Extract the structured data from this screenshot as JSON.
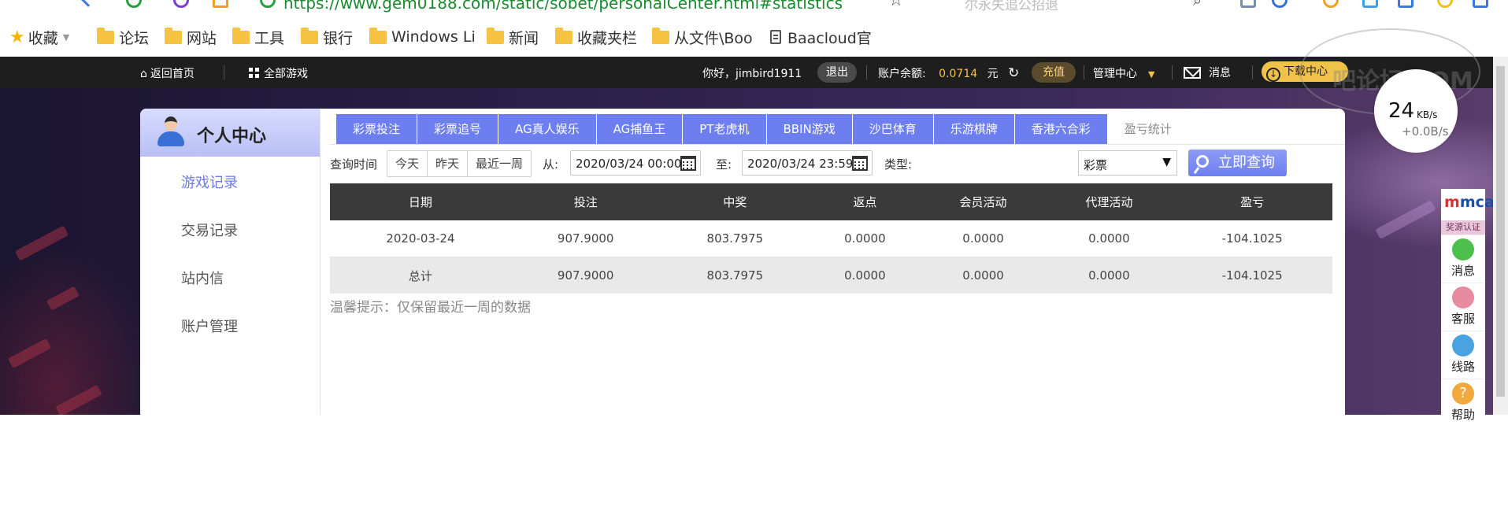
{
  "browser": {
    "address_visible_text": "https://www.gem0188.com/static/sobet/personalCenter.html#statistics",
    "search_placeholder": "尔永失追公招退",
    "bookmarks": [
      {
        "label": "收藏",
        "type": "star"
      },
      {
        "label": "论坛",
        "type": "folder"
      },
      {
        "label": "网站",
        "type": "folder"
      },
      {
        "label": "工具",
        "type": "folder"
      },
      {
        "label": "银行",
        "type": "folder"
      },
      {
        "label": "Windows Li",
        "type": "folder"
      },
      {
        "label": "新闻",
        "type": "folder"
      },
      {
        "label": "收藏夹栏",
        "type": "folder"
      },
      {
        "label": "从文件\\Boo",
        "type": "folder"
      },
      {
        "label": "Baacloud官",
        "type": "doc"
      }
    ]
  },
  "topbar": {
    "home": "返回首页",
    "all_games": "全部游戏",
    "greeting": "你好，jimbird1911",
    "logout": "退出",
    "balance_label": "账户余额:",
    "balance_value": "0.0714",
    "balance_unit": "元",
    "recharge": "充值",
    "admin": "管理中心",
    "messages": "消息",
    "download": "下载中心"
  },
  "sidebar": {
    "title": "个人中心",
    "items": [
      {
        "label": "游戏记录",
        "active": true
      },
      {
        "label": "交易记录",
        "active": false
      },
      {
        "label": "站内信",
        "active": false
      },
      {
        "label": "账户管理",
        "active": false
      }
    ]
  },
  "tabs": [
    {
      "label": "彩票投注",
      "active": false
    },
    {
      "label": "彩票追号",
      "active": false
    },
    {
      "label": "AG真人娱乐",
      "active": false
    },
    {
      "label": "AG捕鱼王",
      "active": false
    },
    {
      "label": "PT老虎机",
      "active": false
    },
    {
      "label": "BBIN游戏",
      "active": false
    },
    {
      "label": "沙巴体育",
      "active": false
    },
    {
      "label": "乐游棋牌",
      "active": false
    },
    {
      "label": "香港六合彩",
      "active": false
    },
    {
      "label": "盈亏统计",
      "active": true
    }
  ],
  "query": {
    "time_label": "查询时间",
    "quick": [
      "今天",
      "昨天",
      "最近一周"
    ],
    "from_label": "从:",
    "from_value": "2020/03/24 00:00",
    "to_label": "至:",
    "to_value": "2020/03/24 23:59",
    "type_label": "类型:",
    "type_value": "彩票",
    "submit": "立即查询"
  },
  "table": {
    "columns": [
      "日期",
      "投注",
      "中奖",
      "返点",
      "会员活动",
      "代理活动",
      "盈亏"
    ],
    "rows": [
      [
        "2020-03-24",
        "907.9000",
        "803.7975",
        "0.0000",
        "0.0000",
        "0.0000",
        "-104.1025"
      ],
      [
        "总计",
        "907.9000",
        "803.7975",
        "0.0000",
        "0.0000",
        "0.0000",
        "-104.1025"
      ]
    ]
  },
  "hint": "温馨提示：仅保留最近一周的数据",
  "speed_widget": {
    "big": "24",
    "unit": "KB/s",
    "small": "+0.0B/s"
  },
  "watermark": "吧论坛.COM",
  "right_bar": {
    "logo_main": "mcai",
    "logo_caption": "奖源认证",
    "items": [
      {
        "label": "消息",
        "color": "#4cbf4c"
      },
      {
        "label": "客服",
        "color": "#e88aa0"
      },
      {
        "label": "线路",
        "color": "#4aa3e0"
      },
      {
        "label": "帮助",
        "color": "#f2a93b"
      }
    ]
  },
  "colors": {
    "accent": "#6d7ef0",
    "topbar": "#1e1e1e",
    "gold": "#f0c24a"
  }
}
